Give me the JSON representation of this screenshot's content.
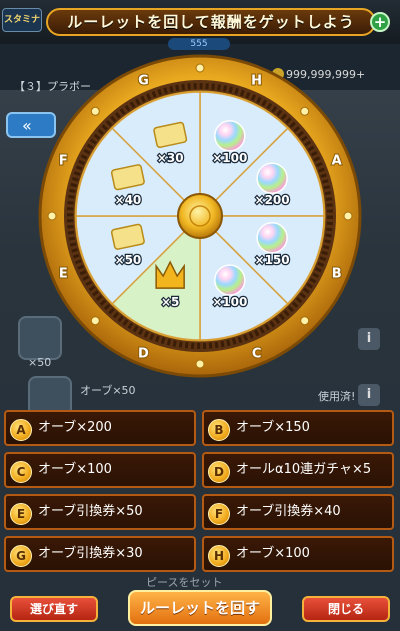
{
  "header": {
    "stamina_label": "スタミナ",
    "title": "ルーレットを回して報酬をゲットしよう",
    "plus_label": "+",
    "sub_counter": "555"
  },
  "background": {
    "currency": "999,999,999+",
    "title": "【３】プラボー",
    "back_icon": "double-left-arrow-icon",
    "orb_count": "×50",
    "item_label": "オーブ×50",
    "used_label": "使用済!",
    "info": "i",
    "footer": "ピースをセット"
  },
  "wheel": {
    "letters": [
      "H",
      "A",
      "B",
      "C",
      "D",
      "E",
      "F",
      "G"
    ],
    "segments": [
      {
        "letter": "H",
        "label": "×100",
        "icon": "rainbow-orb-icon"
      },
      {
        "letter": "A",
        "label": "×200",
        "icon": "rainbow-orb-icon"
      },
      {
        "letter": "B",
        "label": "×150",
        "icon": "rainbow-orb-icon"
      },
      {
        "letter": "C",
        "label": "×100",
        "icon": "rainbow-orb-icon"
      },
      {
        "letter": "D",
        "label": "×5",
        "icon": "gold-crown-icon"
      },
      {
        "letter": "E",
        "label": "×50",
        "icon": "orb-ticket-icon"
      },
      {
        "letter": "F",
        "label": "×40",
        "icon": "orb-ticket-icon"
      },
      {
        "letter": "G",
        "label": "×30",
        "icon": "orb-ticket-icon"
      }
    ],
    "colors": {
      "rim": "#e9a91f",
      "inner_blue": "#d9ecfb",
      "highlight_green": "#d8f2c8"
    }
  },
  "rewards": [
    {
      "letter": "A",
      "text": "オーブ×200"
    },
    {
      "letter": "B",
      "text": "オーブ×150"
    },
    {
      "letter": "C",
      "text": "オーブ×100"
    },
    {
      "letter": "D",
      "text": "オールα10連ガチャ×5"
    },
    {
      "letter": "E",
      "text": "オーブ引換券×50"
    },
    {
      "letter": "F",
      "text": "オーブ引換券×40"
    },
    {
      "letter": "G",
      "text": "オーブ引換券×30"
    },
    {
      "letter": "H",
      "text": "オーブ×100"
    }
  ],
  "buttons": {
    "reselect": "選び直す",
    "spin": "ルーレットを回す",
    "close": "閉じる"
  }
}
